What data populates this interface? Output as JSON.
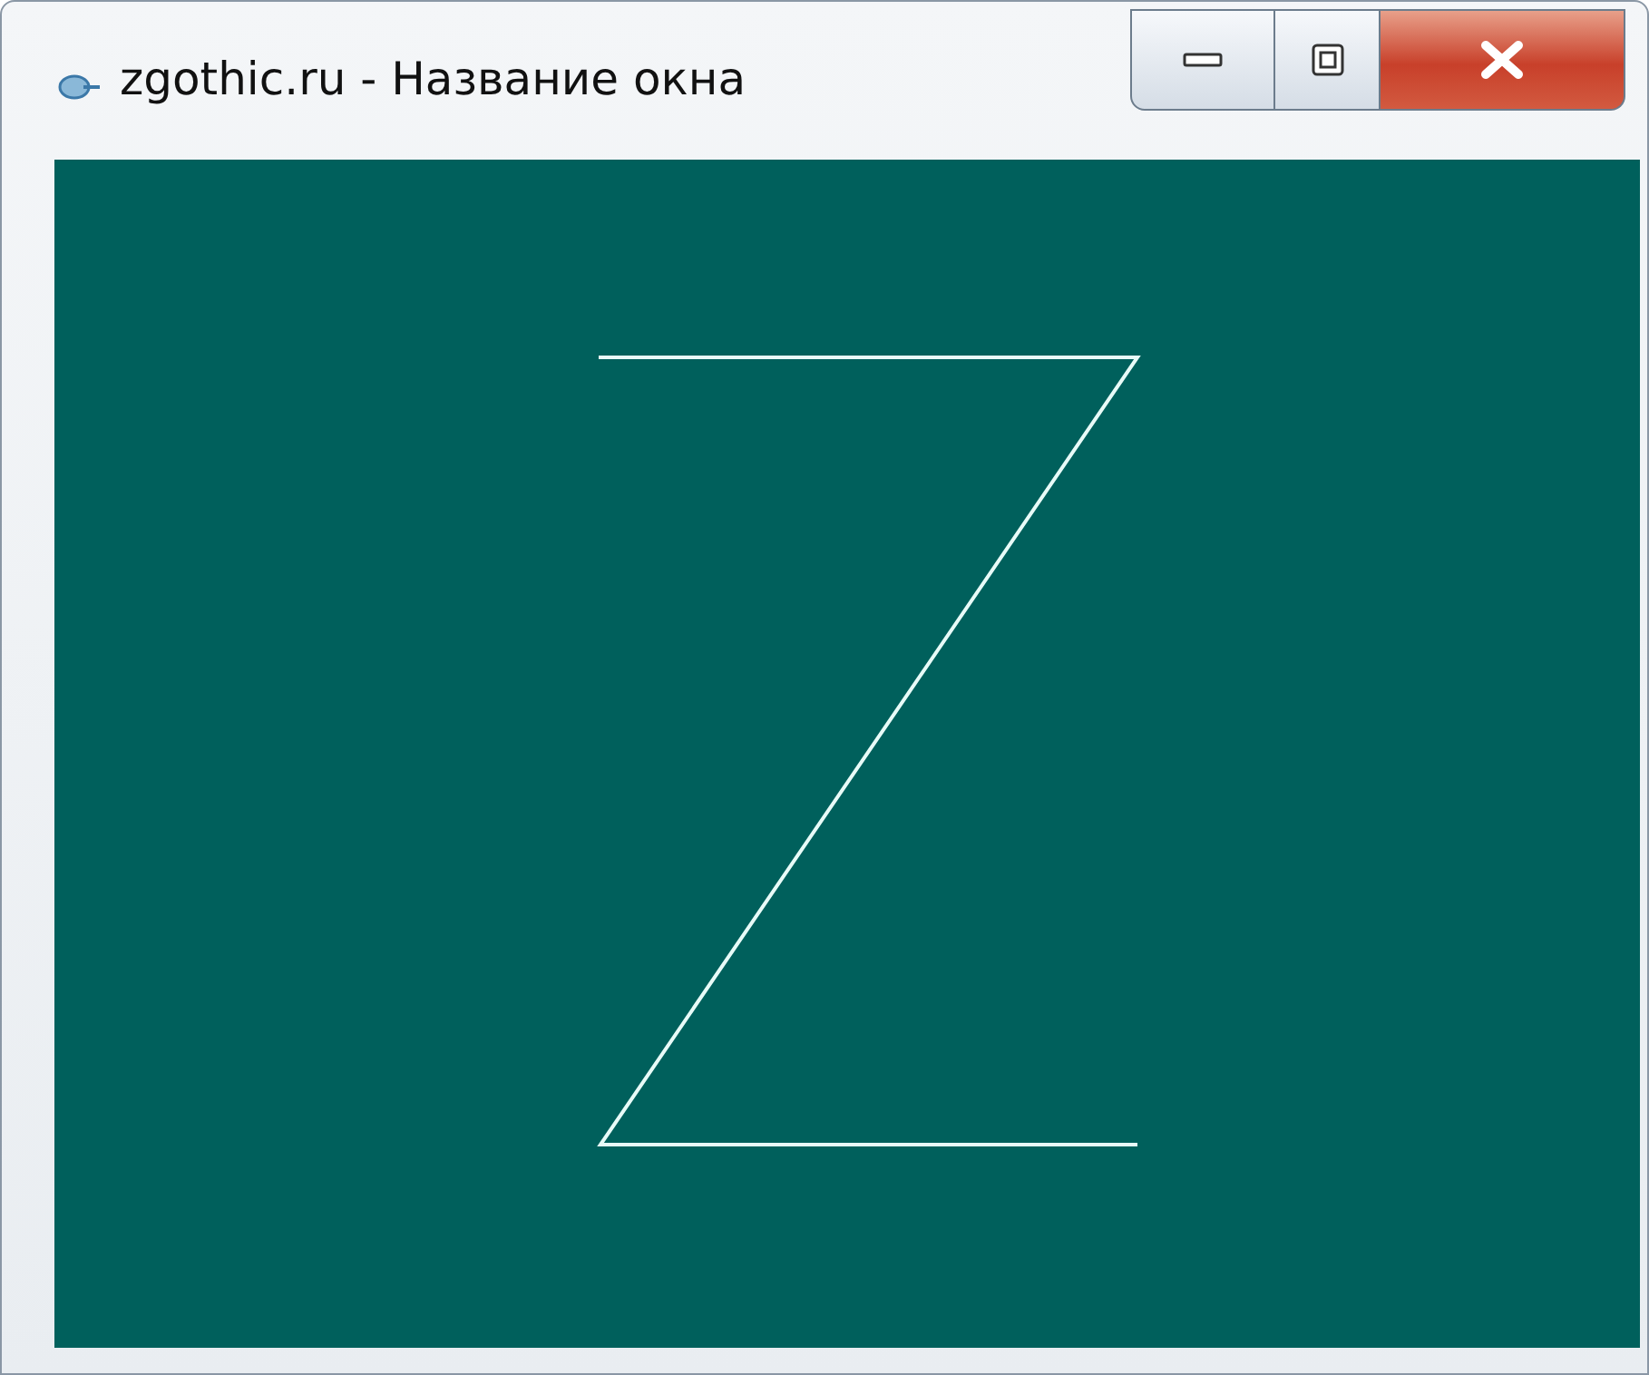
{
  "window": {
    "title": "zgothic.ru - Название окна"
  }
}
